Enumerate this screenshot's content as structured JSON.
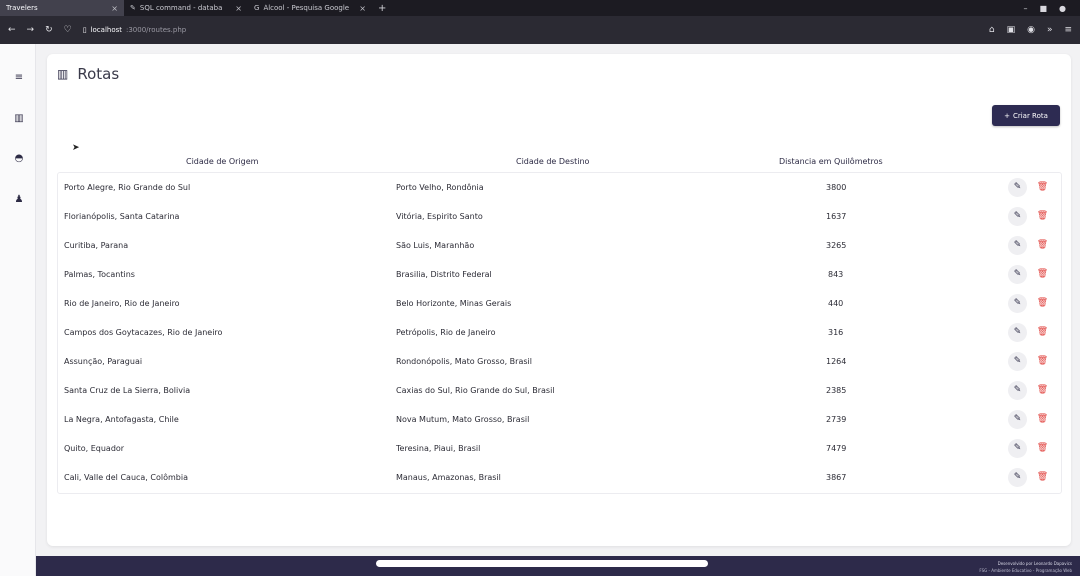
{
  "browser": {
    "tabs": [
      {
        "title": "Travelers",
        "active": true
      },
      {
        "title": "SQL command - databa",
        "active": false
      },
      {
        "title": "Álcool - Pesquisa Google",
        "active": false
      }
    ],
    "url_host": "localhost",
    "url_rest": ":3000/routes.php"
  },
  "page": {
    "title": "Rotas",
    "create_button": "Criar Rota"
  },
  "table": {
    "headers": {
      "origin": "Cidade de Origem",
      "destination": "Cidade de Destino",
      "distance": "Distancia em Quilômetros"
    },
    "rows": [
      {
        "origin": "Porto Alegre, Rio Grande do Sul",
        "destination": "Porto Velho, Rondônia",
        "distance": "3800"
      },
      {
        "origin": "Florianópolis, Santa Catarina",
        "destination": "Vitória, Espirito Santo",
        "distance": "1637"
      },
      {
        "origin": "Curitiba, Parana",
        "destination": "São Luis, Maranhão",
        "distance": "3265"
      },
      {
        "origin": "Palmas, Tocantins",
        "destination": "Brasilia, Distrito Federal",
        "distance": "843"
      },
      {
        "origin": "Rio de Janeiro, Rio de Janeiro",
        "destination": "Belo Horizonte, Minas Gerais",
        "distance": "440"
      },
      {
        "origin": "Campos dos Goytacazes, Rio de Janeiro",
        "destination": "Petrópolis, Rio de Janeiro",
        "distance": "316"
      },
      {
        "origin": "Assunção, Paraguai",
        "destination": "Rondonópolis, Mato Grosso, Brasil",
        "distance": "1264"
      },
      {
        "origin": "Santa Cruz de La Sierra, Bolivia",
        "destination": "Caxias do Sul, Rio Grande do Sul, Brasil",
        "distance": "2385"
      },
      {
        "origin": "La Negra, Antofagasta, Chile",
        "destination": "Nova Mutum, Mato Grosso, Brasil",
        "distance": "2739"
      },
      {
        "origin": "Quito, Equador",
        "destination": "Teresina, Piaui, Brasil",
        "distance": "7479"
      },
      {
        "origin": "Cali, Valle del Cauca, Colômbia",
        "destination": "Manaus, Amazonas, Brasil",
        "distance": "3867"
      }
    ]
  },
  "footer": {
    "credit_line1": "Desenvolvido por Leonardo Dapavics",
    "credit_line2": "FSG - Ambiente Educativo - Programação Web"
  },
  "colors": {
    "primary": "#2d2b52",
    "delete": "#e0403c",
    "footer_bg": "#2d2a4a"
  }
}
